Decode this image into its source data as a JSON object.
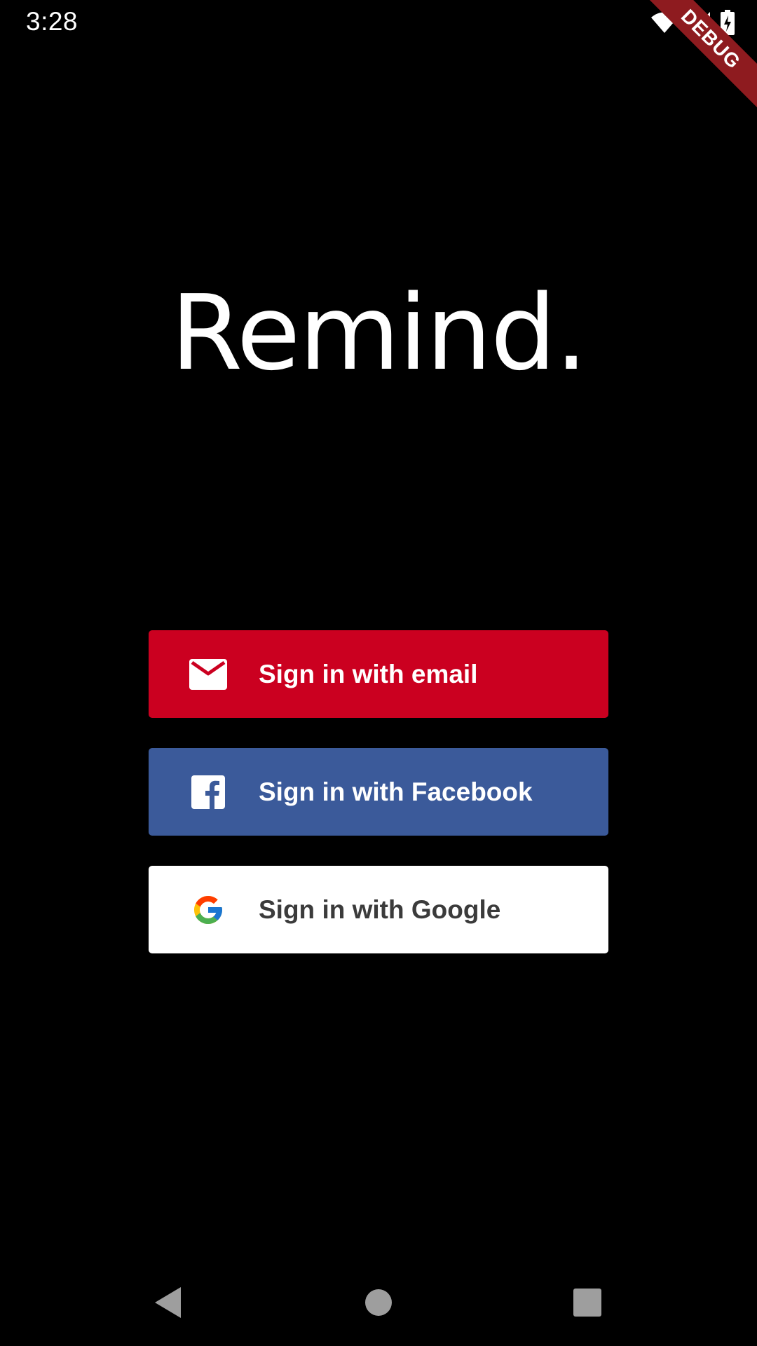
{
  "status_bar": {
    "time": "3:28",
    "icons": [
      "wifi-icon",
      "cellular-signal-icon",
      "battery-charging-icon"
    ]
  },
  "debug_banner": {
    "label": "DEBUG",
    "color": "#8e1b1f"
  },
  "app": {
    "title": "Remind."
  },
  "auth": {
    "buttons": [
      {
        "label": "Sign in with email",
        "icon": "email-icon",
        "background": "#cb0020",
        "text_color": "#ffffff"
      },
      {
        "label": "Sign in with Facebook",
        "icon": "facebook-icon",
        "background": "#3b5a9a",
        "text_color": "#ffffff"
      },
      {
        "label": "Sign in with Google",
        "icon": "google-icon",
        "background": "#ffffff",
        "text_color": "#3b3b3b"
      }
    ]
  },
  "navigation": {
    "buttons": [
      "back-icon",
      "home-icon",
      "recents-icon"
    ]
  }
}
